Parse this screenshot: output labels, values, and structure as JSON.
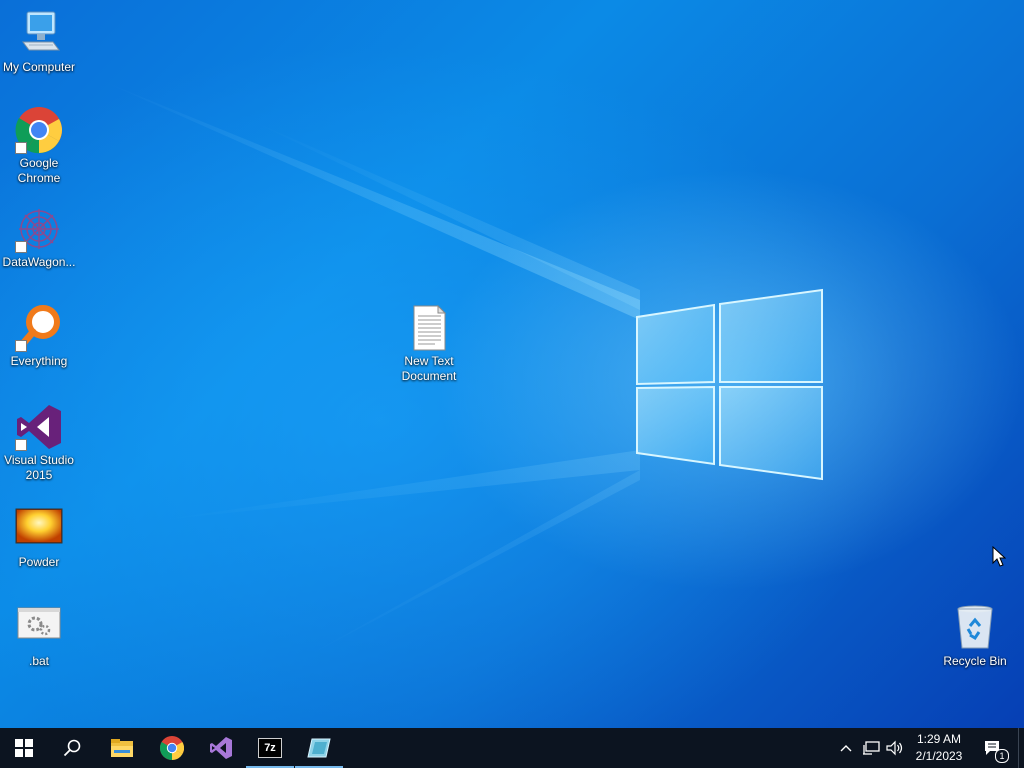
{
  "desktop": {
    "icons": [
      {
        "label": "My Computer",
        "icon": "my-computer-icon"
      },
      {
        "label": "Google Chrome",
        "icon": "google-chrome-icon"
      },
      {
        "label": "DataWagon...",
        "icon": "datawagon-icon"
      },
      {
        "label": "Everything",
        "icon": "everything-search-icon"
      },
      {
        "label": "Visual Studio 2015",
        "icon": "visual-studio-icon"
      },
      {
        "label": "Powder",
        "icon": "powder-icon"
      },
      {
        "label": ".bat",
        "icon": "batch-file-icon"
      },
      {
        "label": "New Text Document",
        "icon": "text-document-icon"
      },
      {
        "label": "Recycle Bin",
        "icon": "recycle-bin-icon"
      }
    ]
  },
  "taskbar": {
    "buttons": [
      {
        "icon": "windows-start-icon"
      },
      {
        "icon": "search-icon"
      },
      {
        "icon": "file-explorer-icon"
      },
      {
        "icon": "google-chrome-icon"
      },
      {
        "icon": "visual-studio-icon"
      },
      {
        "icon": "7zip-icon",
        "text": "7z"
      },
      {
        "icon": "powder-app-icon"
      }
    ],
    "tray": {
      "icons": [
        "chevron-up-icon",
        "network-icon",
        "volume-icon",
        "notification-icon"
      ],
      "notification_count": "1"
    },
    "clock": {
      "time": "1:29 AM",
      "date": "2/1/2023"
    }
  },
  "colors": {
    "taskbar": "#0c1420",
    "accent": "#76b9ed",
    "wallpaper": "#0a6fd8"
  }
}
